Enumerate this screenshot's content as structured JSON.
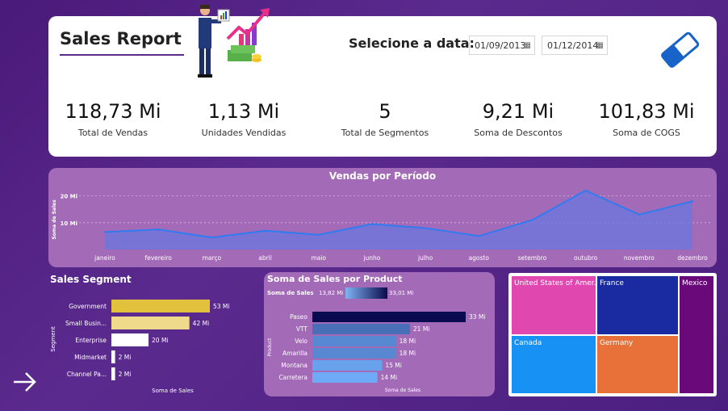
{
  "header": {
    "title": "Sales Report",
    "date_label": "Selecione a data:",
    "date_start": "01/09/2013",
    "date_end": "01/12/2014"
  },
  "kpis": [
    {
      "value": "118,73 Mi",
      "label": "Total de Vendas"
    },
    {
      "value": "1,13 Mi",
      "label": "Unidades Vendidas"
    },
    {
      "value": "5",
      "label": "Total de Segmentos"
    },
    {
      "value": "9,21 Mi",
      "label": "Soma de Descontos"
    },
    {
      "value": "101,83 Mi",
      "label": "Soma de COGS"
    }
  ],
  "icons": {
    "calendar": "calendar-icon",
    "eraser": "eraser-icon",
    "next": "arrow-right-icon",
    "hero": "businessman-chart-illustration"
  },
  "colors": {
    "background": "#4a1a7a",
    "panel": "#a36ab8",
    "line": "#2f7bf0",
    "segment_high": "#e2c23d",
    "segment_mid": "#efd98a",
    "segment_low": "#ffffff"
  },
  "chart_data": [
    {
      "type": "area",
      "title": "Vendas por Período",
      "ylabel": "Soma de Sales",
      "yticks": [
        "10 Mi",
        "20 Mi"
      ],
      "categories": [
        "janeiro",
        "fevereiro",
        "março",
        "abril",
        "maio",
        "junho",
        "julho",
        "agosto",
        "setembro",
        "outubro",
        "novembro",
        "dezembro"
      ],
      "values": [
        6.5,
        7.5,
        4.5,
        7,
        5.5,
        9.5,
        8,
        5,
        11,
        22,
        13,
        18
      ],
      "ylim": [
        0,
        25
      ],
      "grid": true
    },
    {
      "type": "bar",
      "title": "Sales Segment",
      "xlabel": "Soma de Sales",
      "ylabel": "Segment",
      "categories": [
        "Government",
        "Small Busin...",
        "Enterprise",
        "Midmarket",
        "Channel Pa..."
      ],
      "values": [
        53,
        42,
        20,
        2,
        2
      ],
      "labels": [
        "53 Mi",
        "42 Mi",
        "20 Mi",
        "2 Mi",
        "2 Mi"
      ]
    },
    {
      "type": "bar",
      "title": "Soma de Sales por Product",
      "xlabel": "Soma de Sales",
      "ylabel": "Product",
      "legend_title": "Soma de  Sales",
      "legend_min": "13,82 Mi",
      "legend_max": "33,01 Mi",
      "categories": [
        "Paseo",
        "VTT",
        "Velo",
        "Amarilla",
        "Montana",
        "Carretera"
      ],
      "values": [
        33,
        21,
        18,
        18,
        15,
        14
      ],
      "labels": [
        "33 Mi",
        "21 Mi",
        "18 Mi",
        "18 Mi",
        "15 Mi",
        "14 Mi"
      ]
    },
    {
      "type": "treemap",
      "categories": [
        "United States of Amer...",
        "France",
        "Mexico",
        "Canada",
        "Germany"
      ],
      "colors": [
        "#e048b0",
        "#1a2aa0",
        "#6a0a7a",
        "#1891f5",
        "#e8713a"
      ]
    }
  ]
}
